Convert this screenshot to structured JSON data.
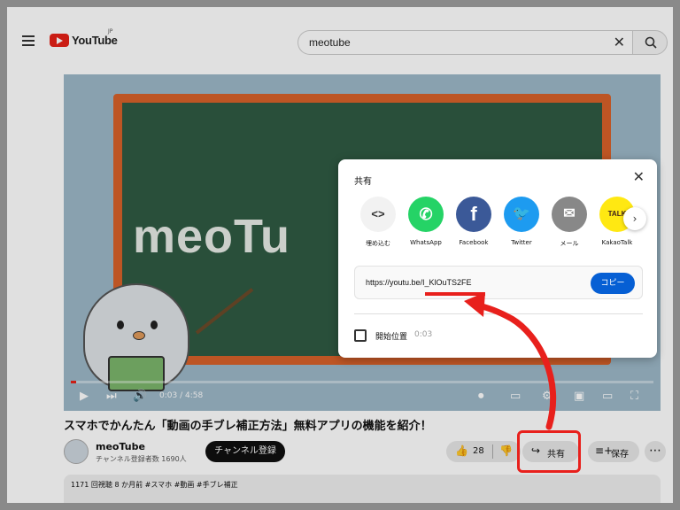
{
  "search": {
    "query": "meotube"
  },
  "logo": {
    "word": "YouTube",
    "region": "JP"
  },
  "video": {
    "board_text": "meoTu",
    "time": "0:03 / 4:58",
    "title": "スマホでかんたん「動画の手ブレ補正方法」無料アプリの機能を紹介！"
  },
  "channel": {
    "name": "meoTube",
    "subs": "チャンネル登録者数 1690人",
    "subscribe": "チャンネル登録"
  },
  "actions": {
    "likes": "28",
    "share": "共有",
    "save": "保存",
    "more": "⋯"
  },
  "description": {
    "meta": "1171 回視聴  8 か月前  #スマホ #動画 #手ブレ補正"
  },
  "share_dialog": {
    "title": "共有",
    "targets": [
      {
        "label": "埋め込む",
        "glyph": "<>",
        "color": "#f2f2f2",
        "text_color": "#333"
      },
      {
        "label": "WhatsApp",
        "glyph": "✆",
        "color": "#25d366",
        "text_color": "#ffffff"
      },
      {
        "label": "Facebook",
        "glyph": "f",
        "color": "#3b5998",
        "text_color": "#ffffff"
      },
      {
        "label": "Twitter",
        "glyph": "🐦",
        "color": "#1d9bf0",
        "text_color": "#ffffff"
      },
      {
        "label": "メール",
        "glyph": "✉",
        "color": "#888888",
        "text_color": "#ffffff"
      },
      {
        "label": "KakaoTalk",
        "glyph": "TALK",
        "color": "#ffe812",
        "text_color": "#3a1d1d"
      }
    ],
    "next": "›",
    "url": "https://youtu.be/I_KlOuTS2FE",
    "copy": "コピー",
    "start_label": "開始位置",
    "start_time": "0:03"
  },
  "colors": {
    "annotation": "#e8201c",
    "accent": "#065fd4"
  }
}
